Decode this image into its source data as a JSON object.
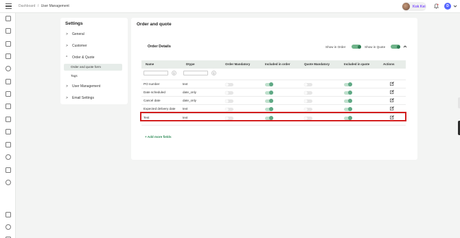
{
  "breadcrumb": {
    "root": "Dashboard",
    "sep": "/",
    "current": "User Management"
  },
  "user": {
    "name": "Kok Kei",
    "initial": "D"
  },
  "settings": {
    "title": "Settings",
    "items": [
      {
        "label": "General",
        "arrow": ">"
      },
      {
        "label": "Customer",
        "arrow": ">"
      },
      {
        "label": "Order & Quote",
        "arrow": "^"
      },
      {
        "label": "User Management",
        "arrow": ">"
      },
      {
        "label": "Email Settings",
        "arrow": ">"
      }
    ],
    "sub_items": [
      {
        "label": "Order and quote form",
        "active": true
      },
      {
        "label": "Tags",
        "active": false
      }
    ]
  },
  "main": {
    "title": "Order and quote",
    "section_title": "Order Details",
    "show_in_order": "Show in Order",
    "show_in_quote": "Show in Quote",
    "columns": [
      "Name",
      "Dtype",
      "Order Mandatory",
      "Included in order",
      "Quote Mandatory",
      "Included in quote",
      "Actions"
    ],
    "rows": [
      {
        "name": "PO number",
        "dtype": "text",
        "order_mandatory": false,
        "included_in_order": true,
        "quote_mandatory": false,
        "included_in_quote": true
      },
      {
        "name": "Date scheduled",
        "dtype": "date_only",
        "order_mandatory": false,
        "included_in_order": true,
        "quote_mandatory": false,
        "included_in_quote": true
      },
      {
        "name": "Cancel date",
        "dtype": "date_only",
        "order_mandatory": false,
        "included_in_order": true,
        "quote_mandatory": false,
        "included_in_quote": true
      },
      {
        "name": "Expected delivery date",
        "dtype": "text",
        "order_mandatory": false,
        "included_in_order": true,
        "quote_mandatory": false,
        "included_in_quote": true
      },
      {
        "name": "Test",
        "dtype": "text",
        "order_mandatory": false,
        "included_in_order": true,
        "quote_mandatory": false,
        "included_in_quote": true
      }
    ],
    "add_more": "+ Add more fields"
  },
  "colors": {
    "accent": "#2e8b57",
    "toggle_on": "#5fa985",
    "highlight": "#d21c1c",
    "avatar_name": "#7c4dff",
    "badge": "#5566ff"
  }
}
